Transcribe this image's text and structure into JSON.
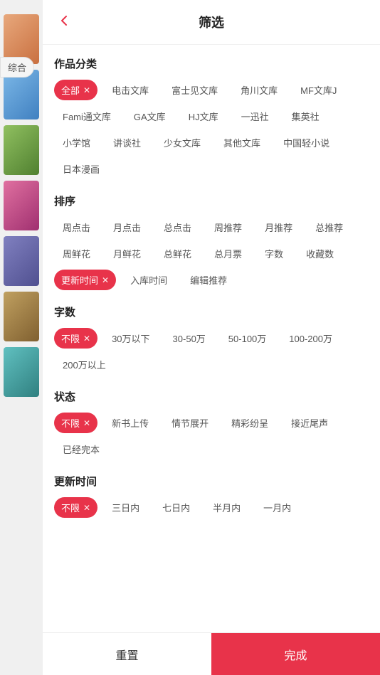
{
  "header": {
    "title": "筛选",
    "back_icon": "‹"
  },
  "sections": {
    "category": {
      "label": "作品分类",
      "tags": [
        {
          "text": "全部",
          "active": true
        },
        {
          "text": "电击文库",
          "active": false
        },
        {
          "text": "富士见文库",
          "active": false
        },
        {
          "text": "角川文库",
          "active": false
        },
        {
          "text": "MF文库J",
          "active": false
        },
        {
          "text": "Fami通文库",
          "active": false
        },
        {
          "text": "GA文库",
          "active": false
        },
        {
          "text": "HJ文库",
          "active": false
        },
        {
          "text": "一迅社",
          "active": false
        },
        {
          "text": "集英社",
          "active": false
        },
        {
          "text": "小学馆",
          "active": false
        },
        {
          "text": "讲谈社",
          "active": false
        },
        {
          "text": "少女文库",
          "active": false
        },
        {
          "text": "其他文库",
          "active": false
        },
        {
          "text": "中国轻小说",
          "active": false
        },
        {
          "text": "日本漫画",
          "active": false
        }
      ]
    },
    "sort": {
      "label": "排序",
      "tags": [
        {
          "text": "周点击",
          "active": false
        },
        {
          "text": "月点击",
          "active": false
        },
        {
          "text": "总点击",
          "active": false
        },
        {
          "text": "周推荐",
          "active": false
        },
        {
          "text": "月推荐",
          "active": false
        },
        {
          "text": "总推荐",
          "active": false
        },
        {
          "text": "周鲜花",
          "active": false
        },
        {
          "text": "月鲜花",
          "active": false
        },
        {
          "text": "总鲜花",
          "active": false
        },
        {
          "text": "总月票",
          "active": false
        },
        {
          "text": "字数",
          "active": false
        },
        {
          "text": "收藏数",
          "active": false
        },
        {
          "text": "更新时间",
          "active": true
        },
        {
          "text": "入库时间",
          "active": false
        },
        {
          "text": "编辑推荐",
          "active": false
        }
      ]
    },
    "wordcount": {
      "label": "字数",
      "tags": [
        {
          "text": "不限",
          "active": true
        },
        {
          "text": "30万以下",
          "active": false
        },
        {
          "text": "30-50万",
          "active": false
        },
        {
          "text": "50-100万",
          "active": false
        },
        {
          "text": "100-200万",
          "active": false
        },
        {
          "text": "200万以上",
          "active": false
        }
      ]
    },
    "status": {
      "label": "状态",
      "tags": [
        {
          "text": "不限",
          "active": true
        },
        {
          "text": "新书上传",
          "active": false
        },
        {
          "text": "情节展开",
          "active": false
        },
        {
          "text": "精彩纷呈",
          "active": false
        },
        {
          "text": "接近尾声",
          "active": false
        },
        {
          "text": "已经完本",
          "active": false
        }
      ]
    },
    "update_time": {
      "label": "更新时间",
      "tags": [
        {
          "text": "不限",
          "active": true
        },
        {
          "text": "三日内",
          "active": false
        },
        {
          "text": "七日内",
          "active": false
        },
        {
          "text": "半月内",
          "active": false
        },
        {
          "text": "一月内",
          "active": false
        }
      ]
    }
  },
  "footer": {
    "reset_label": "重置",
    "confirm_label": "完成"
  },
  "sidebar_badge": "综合",
  "accent_color": "#e8334a"
}
